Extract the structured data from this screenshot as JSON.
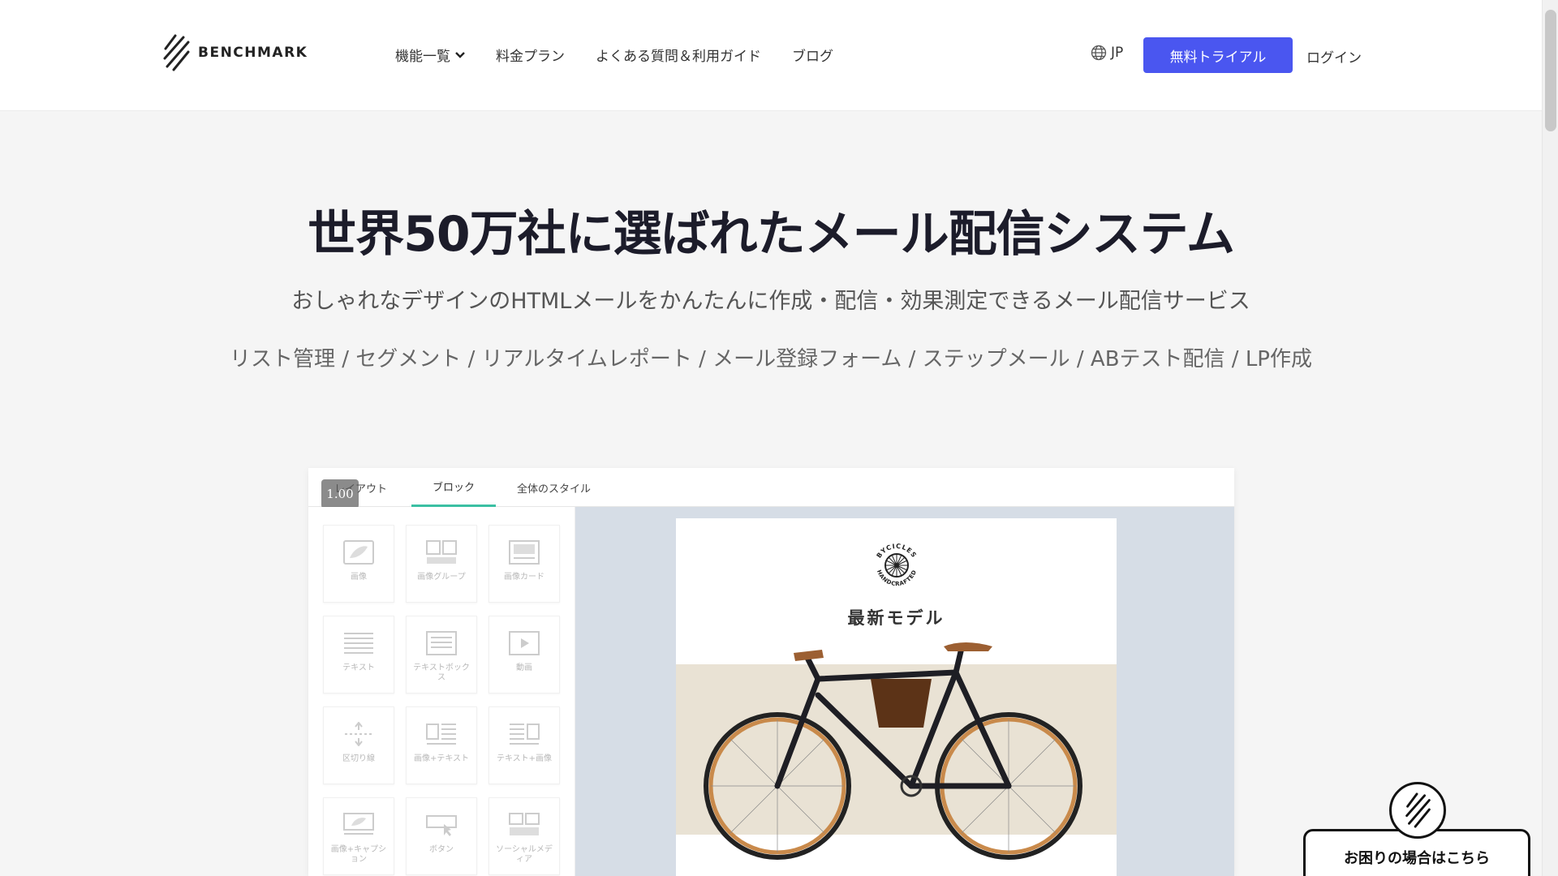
{
  "header": {
    "logo_text": "BENCHMARK",
    "nav": [
      {
        "label": "機能一覧",
        "has_dropdown": true
      },
      {
        "label": "料金プラン"
      },
      {
        "label": "よくある質問＆利用ガイド"
      },
      {
        "label": "ブログ"
      }
    ],
    "language": "JP",
    "cta_label": "無料トライアル",
    "login_label": "ログイン"
  },
  "hero": {
    "title": "世界50万社に選ばれたメール配信システム",
    "subtitle": "おしゃれなデザインのHTMLメールをかんたんに作成・配信・効果測定できるメール配信サービス",
    "features": "リスト管理 / セグメント / リアルタイムレポート / メール登録フォーム / ステップメール / ABテスト配信 / LP作成"
  },
  "editor": {
    "zoom": "1.00",
    "tabs": [
      {
        "label": "レイアウト",
        "active": false
      },
      {
        "label": "ブロック",
        "active": true
      },
      {
        "label": "全体のスタイル",
        "active": false
      }
    ],
    "blocks": [
      {
        "label": "画像",
        "icon": "image-icon"
      },
      {
        "label": "画像グループ",
        "icon": "image-group-icon"
      },
      {
        "label": "画像カード",
        "icon": "image-card-icon"
      },
      {
        "label": "テキスト",
        "icon": "text-icon"
      },
      {
        "label": "テキストボックス",
        "icon": "text-box-icon"
      },
      {
        "label": "動画",
        "icon": "video-icon"
      },
      {
        "label": "区切り線",
        "icon": "divider-icon"
      },
      {
        "label": "画像+テキスト",
        "icon": "image-text-icon"
      },
      {
        "label": "テキスト+画像",
        "icon": "text-image-icon"
      },
      {
        "label": "画像+キャプション",
        "icon": "image-caption-icon"
      },
      {
        "label": "ボタン",
        "icon": "button-icon"
      },
      {
        "label": "ソーシャルメディア",
        "icon": "social-media-icon"
      }
    ],
    "mail": {
      "badge_top": "BYCICLES",
      "badge_bottom": "HANDCRAFTED",
      "title": "最新モデル"
    }
  },
  "help_widget": {
    "label": "お困りの場合はこちら"
  },
  "colors": {
    "accent": "#4a56f0",
    "tab_active": "#3bbfa3",
    "canvas_bg": "#d6dde6"
  }
}
